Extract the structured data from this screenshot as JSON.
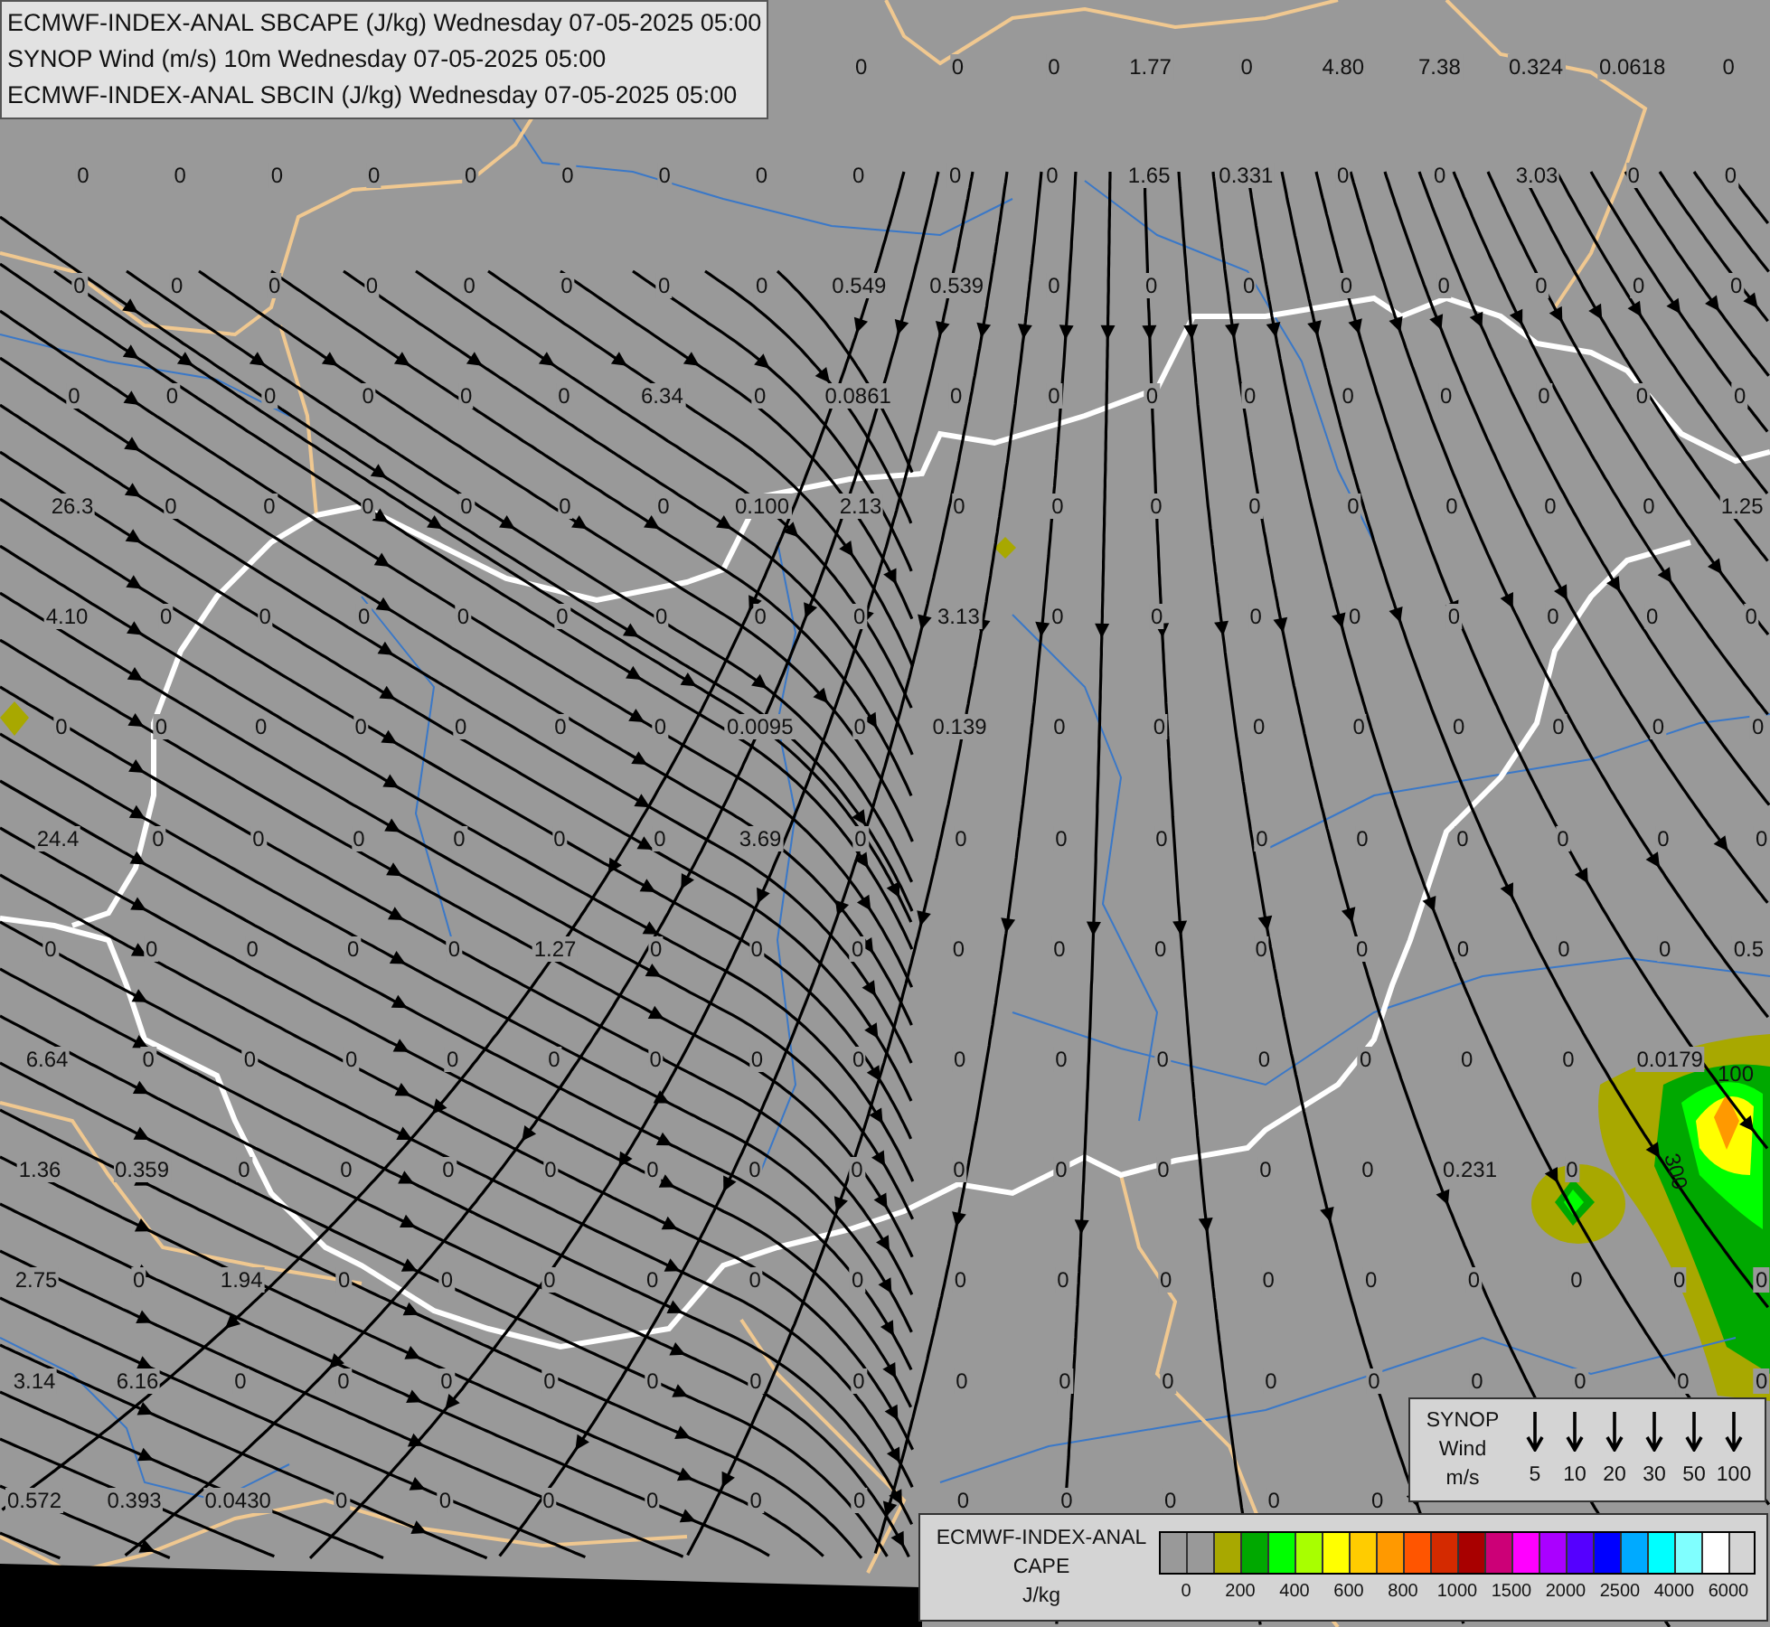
{
  "header": {
    "lines": [
      "ECMWF-INDEX-ANAL SBCAPE (J/kg) Wednesday 07-05-2025 05:00",
      "SYNOP Wind (m/s) 10m Wednesday 07-05-2025 05:00",
      "ECMWF-INDEX-ANAL SBCIN (J/kg) Wednesday 07-05-2025 05:00"
    ]
  },
  "cape_grid": {
    "rows": [
      [
        null,
        null,
        null,
        null,
        null,
        null,
        null,
        null,
        "0",
        "0",
        "0",
        "1.77",
        "0",
        "4.80",
        "7.38",
        "0.324",
        "0.0618",
        "0"
      ],
      [
        "0",
        "0",
        "0",
        "0",
        "0",
        "0",
        "0",
        "0",
        "0",
        "0",
        "0",
        "1.65",
        "0.331",
        "0",
        "0",
        "3.03",
        "0",
        "0"
      ],
      [
        "0",
        "0",
        "0",
        "0",
        "0",
        "0",
        "0",
        "0",
        "0.549",
        "0.539",
        "0",
        "0",
        "0",
        "0",
        "0",
        "0",
        "0",
        "0"
      ],
      [
        "0",
        "0",
        "0",
        "0",
        "0",
        "0",
        "6.34",
        "0",
        "0.0861",
        "0",
        "0",
        "0",
        "0",
        "0",
        "0",
        "0",
        "0",
        "0"
      ],
      [
        "26.3",
        "0",
        "0",
        "0",
        "0",
        "0",
        "0",
        "0.100",
        "2.13",
        "0",
        "0",
        "0",
        "0",
        "0",
        "0",
        "0",
        "0",
        "1.25"
      ],
      [
        "4.10",
        "0",
        "0",
        "0",
        "0",
        "0",
        "0",
        "0",
        "0",
        "3.13",
        "0",
        "0",
        "0",
        "0",
        "0",
        "0",
        "0",
        "0"
      ],
      [
        "0",
        "0",
        "0",
        "0",
        "0",
        "0",
        "0",
        "0.0095",
        "0",
        "0.139",
        "0",
        "0",
        "0",
        "0",
        "0",
        "0",
        "0",
        "0"
      ],
      [
        "24.4",
        "0",
        "0",
        "0",
        "0",
        "0",
        "0",
        "3.69",
        "0",
        "0",
        "0",
        "0",
        "0",
        "0",
        "0",
        "0",
        "0",
        "0"
      ],
      [
        "0",
        "0",
        "0",
        "0",
        "0",
        "1.27",
        "0",
        "0",
        "0",
        "0",
        "0",
        "0",
        "0",
        "0",
        "0",
        "0",
        "0",
        "0.5"
      ],
      [
        "6.64",
        "0",
        "0",
        "0",
        "0",
        "0",
        "0",
        "0",
        "0",
        "0",
        "0",
        "0",
        "0",
        "0",
        "0",
        "0",
        "0.0179"
      ],
      [
        "1.36",
        "0.359",
        "0",
        "0",
        "0",
        "0",
        "0",
        "0",
        "0",
        "0",
        "0",
        "0",
        "0",
        "0",
        "0.231",
        "0"
      ],
      [
        "2.75",
        "0",
        "1.94",
        "0",
        "0",
        "0",
        "0",
        "0",
        "0",
        "0",
        "0",
        "0",
        "0",
        "0",
        "0",
        "0",
        "0",
        "0"
      ],
      [
        "3.14",
        "6.16",
        "0",
        "0",
        "0",
        "0",
        "0",
        "0",
        "0",
        "0",
        "0",
        "0",
        "0",
        "0",
        "0",
        "0",
        "0",
        "0"
      ],
      [
        "0.572",
        "0.393",
        "0.0430",
        "0",
        "0",
        "0",
        "0",
        "0",
        "0",
        "0",
        "0",
        "0",
        "0",
        "0"
      ]
    ]
  },
  "contour_labels": [
    {
      "text": "100"
    },
    {
      "text": "300"
    }
  ],
  "wind_legend": {
    "title_lines": [
      "SYNOP",
      "Wind",
      "m/s"
    ],
    "speeds": [
      "5",
      "10",
      "20",
      "30",
      "50",
      "100"
    ]
  },
  "cape_legend": {
    "title_lines": [
      "ECMWF-INDEX-ANAL",
      "CAPE",
      "J/kg"
    ],
    "swatches": [
      {
        "color": "#999999"
      },
      {
        "color": "#999999"
      },
      {
        "color": "#a8a800"
      },
      {
        "color": "#00a800"
      },
      {
        "color": "#00ff00"
      },
      {
        "color": "#a8ff00"
      },
      {
        "color": "#ffff00"
      },
      {
        "color": "#ffcc00"
      },
      {
        "color": "#ff9900"
      },
      {
        "color": "#ff5500"
      },
      {
        "color": "#d42a00"
      },
      {
        "color": "#a80000"
      },
      {
        "color": "#cc0077"
      },
      {
        "color": "#ff00ff"
      },
      {
        "color": "#aa00ff"
      },
      {
        "color": "#5500ff"
      },
      {
        "color": "#0000ff"
      },
      {
        "color": "#00aaff"
      },
      {
        "color": "#00ffff"
      },
      {
        "color": "#80ffff"
      },
      {
        "color": "#ffffff"
      }
    ],
    "tick_labels": [
      "0",
      "200",
      "400",
      "600",
      "800",
      "1000",
      "1500",
      "2000",
      "2500",
      "4000",
      "6000"
    ]
  }
}
